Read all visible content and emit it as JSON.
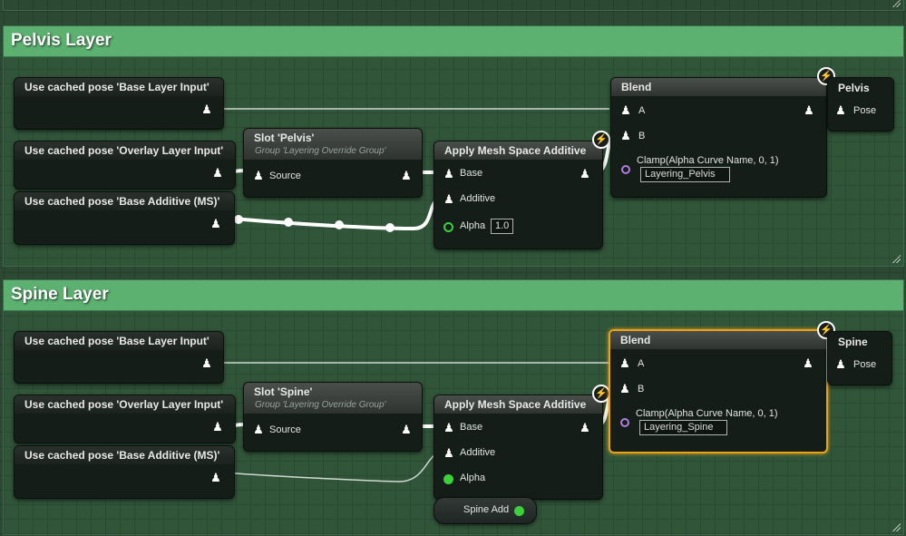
{
  "pelvis_layer": {
    "title": "Pelvis Layer",
    "cached_base": {
      "title": "Use cached pose 'Base Layer Input'"
    },
    "cached_overlay": {
      "title": "Use cached pose 'Overlay Layer Input'"
    },
    "cached_additive": {
      "title": "Use cached pose 'Base Additive (MS)'"
    },
    "slot": {
      "title": "Slot 'Pelvis'",
      "group": "Group 'Layering Override Group'",
      "pin_source": "Source"
    },
    "apply": {
      "title": "Apply Mesh Space Additive",
      "pin_base": "Base",
      "pin_additive": "Additive",
      "pin_alpha": "Alpha",
      "alpha_value": "1.0"
    },
    "blend": {
      "title": "Blend",
      "pin_a": "A",
      "pin_b": "B",
      "pin_alpha": "Clamp(Alpha Curve Name, 0, 1)",
      "alpha_value": "Layering_Pelvis"
    },
    "result": {
      "title": "Pelvis",
      "pin_pose": "Pose"
    }
  },
  "spine_layer": {
    "title": "Spine Layer",
    "cached_base": {
      "title": "Use cached pose 'Base Layer Input'"
    },
    "cached_overlay": {
      "title": "Use cached pose 'Overlay Layer Input'"
    },
    "cached_additive": {
      "title": "Use cached pose 'Base Additive (MS)'"
    },
    "slot": {
      "title": "Slot 'Spine'",
      "group": "Group 'Layering Override Group'",
      "pin_source": "Source"
    },
    "apply": {
      "title": "Apply Mesh Space Additive",
      "pin_base": "Base",
      "pin_additive": "Additive",
      "pin_alpha": "Alpha"
    },
    "variable": {
      "label": "Spine Add"
    },
    "blend": {
      "title": "Blend",
      "pin_a": "A",
      "pin_b": "B",
      "pin_alpha": "Clamp(Alpha Curve Name, 0, 1)",
      "alpha_value": "Layering_Spine"
    },
    "result": {
      "title": "Spine",
      "pin_pose": "Pose"
    }
  },
  "icons": {
    "pose": "pose-person-icon",
    "fast_path": "lightning-bolt-icon",
    "resize": "resize-grip-icon"
  },
  "colors": {
    "comment_header": "#5cb070",
    "selection": "#e8a317",
    "float_pin": "#3ad13a",
    "name_pin": "#b27de0"
  }
}
